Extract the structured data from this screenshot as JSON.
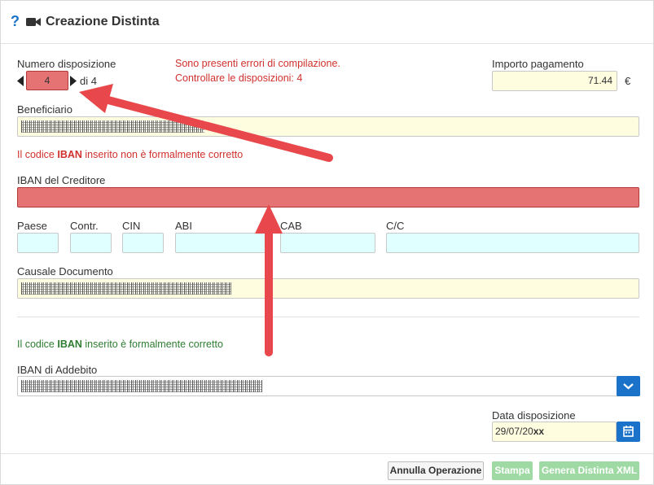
{
  "header": {
    "help_icon": "?",
    "camera_icon": "video-camera-icon",
    "title": "Creazione Distinta"
  },
  "numero": {
    "label": "Numero disposizione",
    "value": "4",
    "of_text": "di 4"
  },
  "errors": {
    "line1": "Sono presenti errori di compilazione.",
    "line2": "Controllare le disposizioni: 4"
  },
  "importo": {
    "label": "Importo pagamento",
    "value": "71.44",
    "currency": "€"
  },
  "beneficiario": {
    "label": "Beneficiario"
  },
  "iban_creditore": {
    "msg_prefix": "Il codice ",
    "msg_keyword": "IBAN",
    "msg_suffix": " inserito non è formalmente corretto",
    "label": "IBAN del Creditore",
    "value": ""
  },
  "bban": {
    "paese": "Paese",
    "contr": "Contr.",
    "cin": "CIN",
    "abi": "ABI",
    "cab": "CAB",
    "cc": "C/C"
  },
  "causale": {
    "label": "Causale Documento"
  },
  "iban_addebito": {
    "msg_prefix": "Il codice ",
    "msg_keyword": "IBAN",
    "msg_suffix": " inserito è formalmente corretto",
    "label": "IBAN di Addebito",
    "dropdown_icon": "chevron-down-icon"
  },
  "data": {
    "label": "Data disposizione",
    "value": "29/07/20",
    "value_suffix": "xx",
    "calendar_icon": "calendar-icon"
  },
  "footer": {
    "annulla": "Annulla Operazione",
    "stampa": "Stampa",
    "genera": "Genera Distinta XML"
  },
  "colors": {
    "accent": "#1a73c8",
    "error": "#d0312d",
    "success": "#2e7d32",
    "invalid_field": "#e57373",
    "annotation_arrow": "#e8474b"
  }
}
